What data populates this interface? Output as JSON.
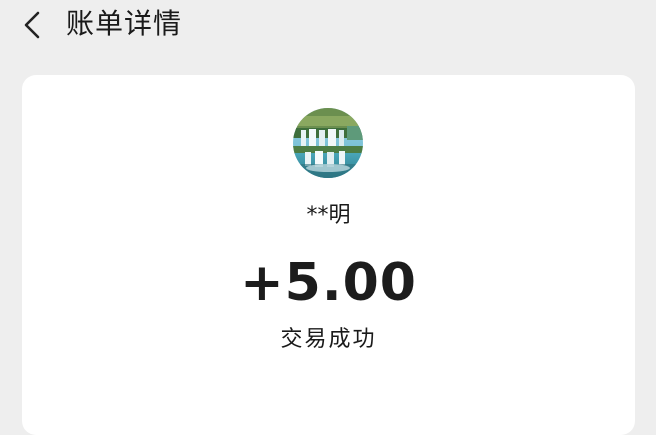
{
  "header": {
    "title": "账单详情"
  },
  "transaction": {
    "payer_name": "**明",
    "amount": "+5.00",
    "status": "交易成功"
  },
  "icons": {
    "back": "chevron-left-icon",
    "avatar": "waterfall-avatar-image"
  },
  "colors": {
    "background": "#eeeeee",
    "card": "#ffffff",
    "text": "#1a1a1a"
  }
}
